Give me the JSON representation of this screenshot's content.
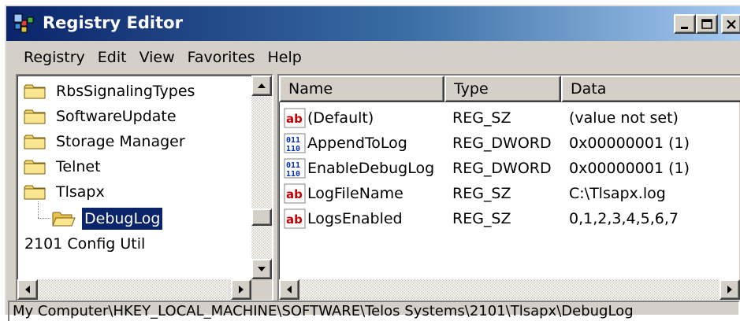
{
  "window": {
    "title": "Registry Editor"
  },
  "menu": [
    "Registry",
    "Edit",
    "View",
    "Favorites",
    "Help"
  ],
  "tree": {
    "items": [
      {
        "label": "RbsSignalingTypes"
      },
      {
        "label": "SoftwareUpdate"
      },
      {
        "label": "Storage Manager"
      },
      {
        "label": "Telnet"
      },
      {
        "label": "Tlsapx"
      },
      {
        "label": "DebugLog",
        "selected": true
      },
      {
        "label": "2101 Config Util"
      }
    ]
  },
  "list": {
    "columns": [
      "Name",
      "Type",
      "Data"
    ],
    "rows": [
      {
        "icon": "string-value-icon",
        "name": "(Default)",
        "type": "REG_SZ",
        "data": "(value not set)"
      },
      {
        "icon": "binary-value-icon",
        "name": "AppendToLog",
        "type": "REG_DWORD",
        "data": "0x00000001 (1)"
      },
      {
        "icon": "binary-value-icon",
        "name": "EnableDebugLog",
        "type": "REG_DWORD",
        "data": "0x00000001 (1)"
      },
      {
        "icon": "string-value-icon",
        "name": "LogFileName",
        "type": "REG_SZ",
        "data": "C:\\Tlsapx.log"
      },
      {
        "icon": "string-value-icon",
        "name": "LogsEnabled",
        "type": "REG_SZ",
        "data": "0,1,2,3,4,5,6,7"
      }
    ]
  },
  "status": {
    "path": "My Computer\\HKEY_LOCAL_MACHINE\\SOFTWARE\\Telos Systems\\2101\\Tlsapx\\DebugLog"
  },
  "colors": {
    "titlebar_start": "#0a246a",
    "titlebar_end": "#a6caf0",
    "chrome": "#d4d0c8",
    "selection": "#0a246a"
  }
}
